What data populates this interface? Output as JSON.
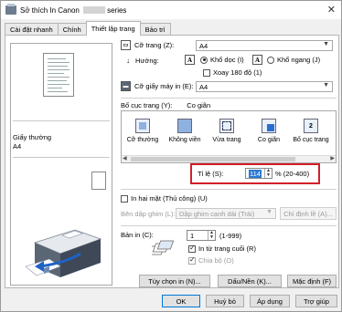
{
  "window": {
    "title_prefix": "Sở thích In Canon",
    "title_suffix": "series",
    "close_glyph": "✕"
  },
  "tabs": [
    {
      "label": "Cài đặt nhanh",
      "active": false
    },
    {
      "label": "Chính",
      "active": false
    },
    {
      "label": "Thiết lập trang",
      "active": true
    },
    {
      "label": "Bảo trì",
      "active": false
    }
  ],
  "preview": {
    "media_label": "Giấy thường",
    "size_label": "A4"
  },
  "page_size": {
    "label": "Cỡ trang (Z):",
    "value": "A4"
  },
  "orientation": {
    "label": "Hướng:",
    "portrait_label": "Khổ dọc (I)",
    "landscape_label": "Khổ ngang (J)",
    "rotate180_label": "Xoay 180 độ (1)",
    "selected": "portrait"
  },
  "printer_paper_size": {
    "label": "Cỡ giấy máy in (E):",
    "value": "A4"
  },
  "page_layout": {
    "label": "Bố cục trang (Y):",
    "current": "Co giãn",
    "items": [
      {
        "label": "Cỡ thường"
      },
      {
        "label": "Không viền"
      },
      {
        "label": "Vừa trang"
      },
      {
        "label": "Co giãn"
      },
      {
        "label": "Bố cục trang"
      }
    ],
    "page_number_icon": "2"
  },
  "scaling": {
    "label": "Tỉ lệ (S):",
    "value": "114",
    "range": "% (20-400)"
  },
  "duplex": {
    "label": "In hai mặt (Thủ công) (U)",
    "stapling_label": "Bên dập ghim (L):",
    "stapling_value": "Dập ghim cạnh dài (Trái)",
    "margin_button": "Chỉ định lề (A)..."
  },
  "copies": {
    "label": "Bản in (C):",
    "value": "1",
    "range": "(1-999)",
    "last_page_first_label": "In từ trang cuối (R)",
    "collate_label": "Chia bộ (O)"
  },
  "footer_buttons": {
    "print_options": "Tùy chọn in (N)...",
    "stamp_background": "Dấu/Nền (K)...",
    "defaults": "Mặc định (F)",
    "ok": "OK",
    "cancel": "Huỷ bỏ",
    "apply": "Áp dụng",
    "help": "Trợ giúp"
  }
}
